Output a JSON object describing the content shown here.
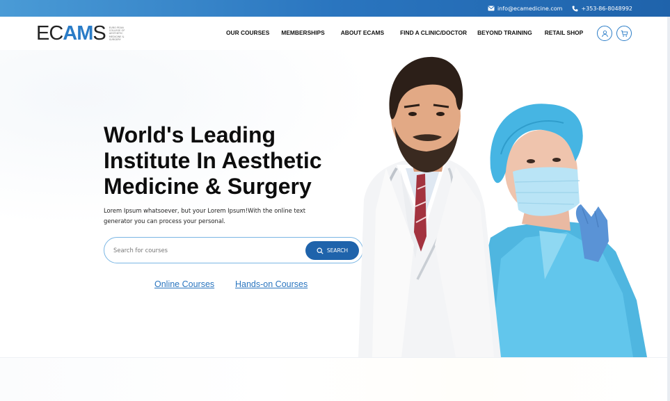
{
  "topbar": {
    "email": "info@ecamedicine.com",
    "phone": "+353-86-8048992",
    "email_icon": "envelope-icon",
    "phone_icon": "phone-icon"
  },
  "logo": {
    "wordmark_left": "EC",
    "wordmark_accent": "AM",
    "wordmark_right": "S",
    "subtitle": "EURO PEAN COLLEGE OF AESTHETIC MEDICINE & SURGERY"
  },
  "nav": {
    "items": [
      "OUR COURSES",
      "MEMBERSHIPS",
      "ABOUT ECAMS",
      "FIND A CLINIC/DOCTOR",
      "BEYOND TRAINING",
      "RETAIL SHOP"
    ],
    "user_icon": "user-icon",
    "cart_icon": "cart-icon"
  },
  "hero": {
    "title": "World's Leading Institute In Aesthetic Medicine & Surgery",
    "description": "Lorem Ipsum whatsoever, but your Lorem Ipsum!With the online text generator you can process your personal.",
    "search_placeholder": "Search for courses",
    "search_button": "SEARCH",
    "search_icon": "search-icon",
    "links": [
      "Online Courses",
      "Hands-on Courses"
    ]
  },
  "colors": {
    "brand_blue": "#2a7cc7",
    "button_blue": "#1f63ab",
    "scrub_blue": "#5fc3ea"
  }
}
